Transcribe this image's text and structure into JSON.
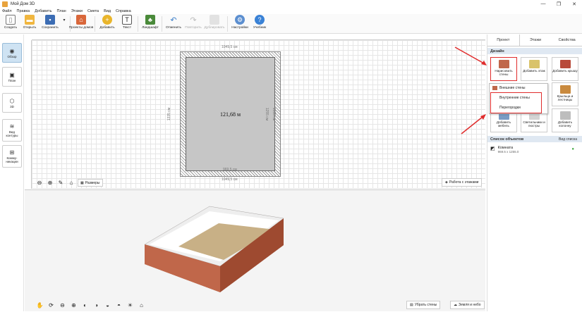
{
  "app": {
    "title": "Мой Дом 3D",
    "window_controls": [
      "—",
      "❐",
      "✕"
    ]
  },
  "menu": [
    "Файл",
    "Правка",
    "Добавить",
    "План",
    "Этажи",
    "Смета",
    "Вид",
    "Справка"
  ],
  "toolbar": {
    "create": "Создать",
    "open": "Открыть",
    "save": "Сохранить",
    "projects": "Проекты домов",
    "add": "Добавить",
    "text": "Текст",
    "landscape": "Ландшафт",
    "undo": "Отменить",
    "redo": "Повторить",
    "duplicate": "Дублировать",
    "settings": "Настройки",
    "tutorial": "Учебник"
  },
  "left_nav": {
    "overview": "Обзор",
    "plan": "План",
    "view3d": "3D",
    "contours": "Вид контуры",
    "communications": "Комму-никации"
  },
  "plan": {
    "outer_width": "1049,5 см",
    "inner_width": "969,5 см",
    "outer_height": "1335 см",
    "inner_height": "1255 см",
    "area": "121,68 м",
    "sizes_label": "Размеры",
    "floors_label": "Работа с этажами"
  },
  "view3d_controls": {
    "hide_walls": "Убрать стены",
    "earth_sky": "Земля и небо"
  },
  "right_panel": {
    "tabs": [
      "Проект",
      "Этажи",
      "Свойства"
    ],
    "design_header": "Дизайн",
    "tiles": {
      "draw_walls": "Нарисовать стены",
      "add_floor": "Добавить этаж",
      "add_roof": "Добавить крышу",
      "porches_stairs": "Крыльца и лестницы",
      "add_furniture": "Добавить мебель",
      "lamps": "Светильники и люстры",
      "add_column": "Добавить колонну"
    },
    "dropdown": [
      "Внешние стены",
      "Внутренние стены",
      "Перегородки"
    ],
    "objects_header": "Список объектов",
    "list_view": "Вид списка",
    "object": {
      "name": "Комната",
      "size": "969.5 x 1255.0"
    }
  }
}
